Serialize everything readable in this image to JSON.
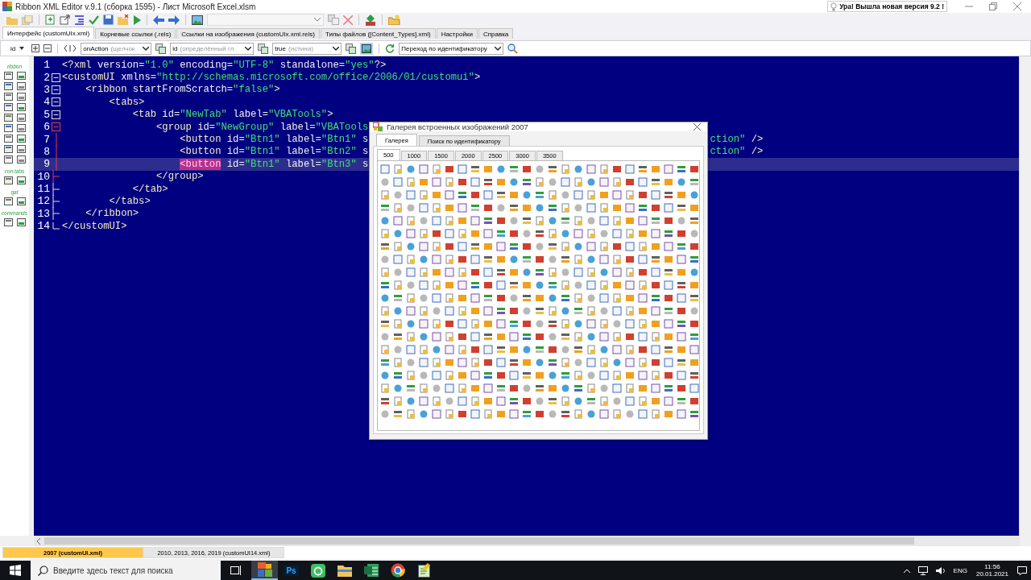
{
  "window": {
    "title": "Ribbon XML Editor v.9.1 (сборка 1595) - Лист Microsoft Excel.xlsm",
    "notice": "Ура! Вышла новая версия 9.2 !"
  },
  "tabs": [
    {
      "label": "Интерфейс (customUIx.xml)",
      "selected": true
    },
    {
      "label": "Корневые ссылки (.rels)",
      "selected": false
    },
    {
      "label": "Ссылки на изображения  (customUIx.xml.rels)",
      "selected": false
    },
    {
      "label": "Типы файлов ([Content_Types].xml)",
      "selected": false
    },
    {
      "label": "Настройки",
      "selected": false
    },
    {
      "label": "Справка",
      "selected": false
    }
  ],
  "toolbar": {
    "mode": "id",
    "combos": [
      {
        "value": "onAction",
        "hint": "(щелчок"
      },
      {
        "value": "id",
        "hint": "(определённый гл"
      },
      {
        "value": "true",
        "hint": "(истина)"
      }
    ],
    "navigation": "Переход по идентификатору"
  },
  "palette": [
    {
      "label": "ribbon"
    },
    {
      "label": "con.tabs"
    },
    {
      "label": "qat"
    },
    {
      "label": "commands"
    }
  ],
  "editor": {
    "lines": [
      {
        "number": "1",
        "kind": "none",
        "current": false,
        "tokens": [
          {
            "kind": "tag",
            "text": "<?xml"
          },
          {
            "kind": "attr",
            "text": " version="
          },
          {
            "kind": "value",
            "text": "\"1.0\""
          },
          {
            "kind": "attr",
            "text": " encoding="
          },
          {
            "kind": "value",
            "text": "\"UTF-8\""
          },
          {
            "kind": "attr",
            "text": " standalone="
          },
          {
            "kind": "value",
            "text": "\"yes\""
          },
          {
            "kind": "tag",
            "text": "?>"
          }
        ]
      },
      {
        "number": "2",
        "kind": "box",
        "current": false,
        "tokens": [
          {
            "kind": "tag",
            "text": "<customUI"
          },
          {
            "kind": "attr",
            "text": " xmlns="
          },
          {
            "kind": "value",
            "text": "\"http://schemas.microsoft.com/office/2006/01/customui\""
          },
          {
            "kind": "tag",
            "text": ">"
          }
        ]
      },
      {
        "number": "3",
        "kind": "box",
        "current": false,
        "tokens": [
          {
            "kind": "tag",
            "text": "    <ribbon"
          },
          {
            "kind": "attr",
            "text": " startFromScratch="
          },
          {
            "kind": "value",
            "text": "\"false\""
          },
          {
            "kind": "tag",
            "text": ">"
          }
        ]
      },
      {
        "number": "4",
        "kind": "box",
        "current": false,
        "tokens": [
          {
            "kind": "tag",
            "text": "        <tabs>"
          }
        ]
      },
      {
        "number": "5",
        "kind": "box",
        "current": false,
        "tokens": [
          {
            "kind": "tag",
            "text": "            <tab"
          },
          {
            "kind": "attr",
            "text": " id="
          },
          {
            "kind": "value",
            "text": "\"NewTab\""
          },
          {
            "kind": "attr",
            "text": " label="
          },
          {
            "kind": "value",
            "text": "\"VBATools\""
          },
          {
            "kind": "tag",
            "text": ">"
          }
        ]
      },
      {
        "number": "6",
        "kind": "box-red",
        "current": false,
        "tokens": [
          {
            "kind": "tag",
            "text": "                <group"
          },
          {
            "kind": "attr",
            "text": " id="
          },
          {
            "kind": "value",
            "text": "\"NewGroup\""
          },
          {
            "kind": "attr",
            "text": " label="
          },
          {
            "kind": "value",
            "text": "\"VBATools"
          }
        ]
      },
      {
        "number": "7",
        "kind": "line-red",
        "current": false,
        "tokens": [
          {
            "kind": "tag",
            "text": "                    <button"
          },
          {
            "kind": "attr",
            "text": " id="
          },
          {
            "kind": "value",
            "text": "\"Btn1\""
          },
          {
            "kind": "attr",
            "text": " label="
          },
          {
            "kind": "value",
            "text": "\"Btn1\""
          },
          {
            "kind": "attr",
            "text": " s"
          }
        ],
        "tail": [
          {
            "kind": "value",
            "text": "ction\""
          },
          {
            "kind": "tag",
            "text": " />"
          }
        ]
      },
      {
        "number": "8",
        "kind": "line-red",
        "current": false,
        "tokens": [
          {
            "kind": "tag",
            "text": "                    <button"
          },
          {
            "kind": "attr",
            "text": " id="
          },
          {
            "kind": "value",
            "text": "\"Btn1\""
          },
          {
            "kind": "attr",
            "text": " label="
          },
          {
            "kind": "value",
            "text": "\"Btn2\""
          },
          {
            "kind": "attr",
            "text": " s"
          }
        ],
        "tail": [
          {
            "kind": "value",
            "text": "ction\""
          },
          {
            "kind": "tag",
            "text": " />"
          }
        ]
      },
      {
        "number": "9",
        "kind": "line-red",
        "current": true,
        "tokens": [
          {
            "kind": "match",
            "text": "                    <button"
          },
          {
            "kind": "attr",
            "text": " id="
          },
          {
            "kind": "value",
            "text": "\"Btn1\""
          },
          {
            "kind": "attr",
            "text": " label="
          },
          {
            "kind": "value",
            "text": "\"Btn3\""
          },
          {
            "kind": "attr",
            "text": " s"
          }
        ]
      },
      {
        "number": "10",
        "kind": "end-red",
        "current": false,
        "tokens": [
          {
            "kind": "tag",
            "text": "                </group>"
          }
        ]
      },
      {
        "number": "11",
        "kind": "end",
        "current": false,
        "tokens": [
          {
            "kind": "tag",
            "text": "            </tab>"
          }
        ]
      },
      {
        "number": "12",
        "kind": "end",
        "current": false,
        "tokens": [
          {
            "kind": "tag",
            "text": "        </tabs>"
          }
        ]
      },
      {
        "number": "13",
        "kind": "end",
        "current": false,
        "tokens": [
          {
            "kind": "tag",
            "text": "    </ribbon>"
          }
        ]
      },
      {
        "number": "14",
        "kind": "last",
        "current": false,
        "tokens": [
          {
            "kind": "tag",
            "text": "</customUI>"
          }
        ]
      }
    ]
  },
  "gallery": {
    "title": "Галерея встроенных изображений 2007",
    "tabs": [
      {
        "label": "Галерея",
        "selected": true
      },
      {
        "label": "Поиск по идентификатору",
        "selected": false
      }
    ],
    "pages": [
      {
        "label": "500",
        "selected": true
      },
      {
        "label": "1000",
        "selected": false
      },
      {
        "label": "1500",
        "selected": false
      },
      {
        "label": "2000",
        "selected": false
      },
      {
        "label": "2500",
        "selected": false
      },
      {
        "label": "3000",
        "selected": false
      },
      {
        "label": "3500",
        "selected": false
      }
    ]
  },
  "bottom_tabs": [
    {
      "label": "2007 (customUI.xml)",
      "selected": true
    },
    {
      "label": "2010, 2013, 2016, 2019 (customUI14.xml)",
      "selected": false
    }
  ],
  "taskbar": {
    "search_placeholder": "Введите здесь текст для поиска",
    "ps_label": "Ps",
    "language": "ENG",
    "time": "11:56",
    "date": "20.01.2021"
  }
}
